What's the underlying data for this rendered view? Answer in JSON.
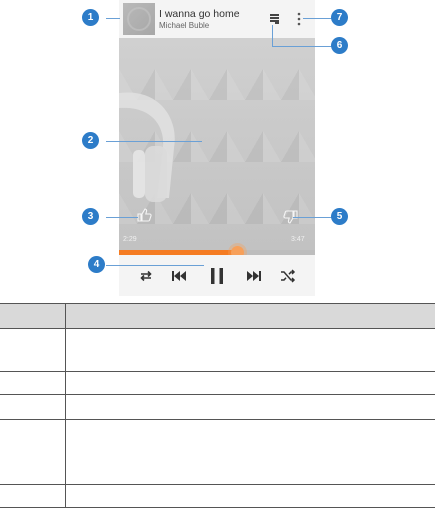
{
  "player": {
    "song_title": "I wanna go home",
    "artist": "Michael Buble",
    "time_elapsed": "2:29",
    "time_total": "3:47",
    "progress_fraction": 0.6,
    "accent_color": "#f57c22"
  },
  "callouts": {
    "n1": "1",
    "n2": "2",
    "n3": "3",
    "n4": "4",
    "n5": "5",
    "n6": "6",
    "n7": "7"
  },
  "table": {
    "header_cells": [
      "",
      ""
    ],
    "rows": [
      {
        "number": "",
        "description": ""
      },
      {
        "number": "",
        "description": ""
      },
      {
        "number": "",
        "description": ""
      },
      {
        "number": "",
        "description": ""
      },
      {
        "number": "",
        "description": ""
      }
    ]
  }
}
